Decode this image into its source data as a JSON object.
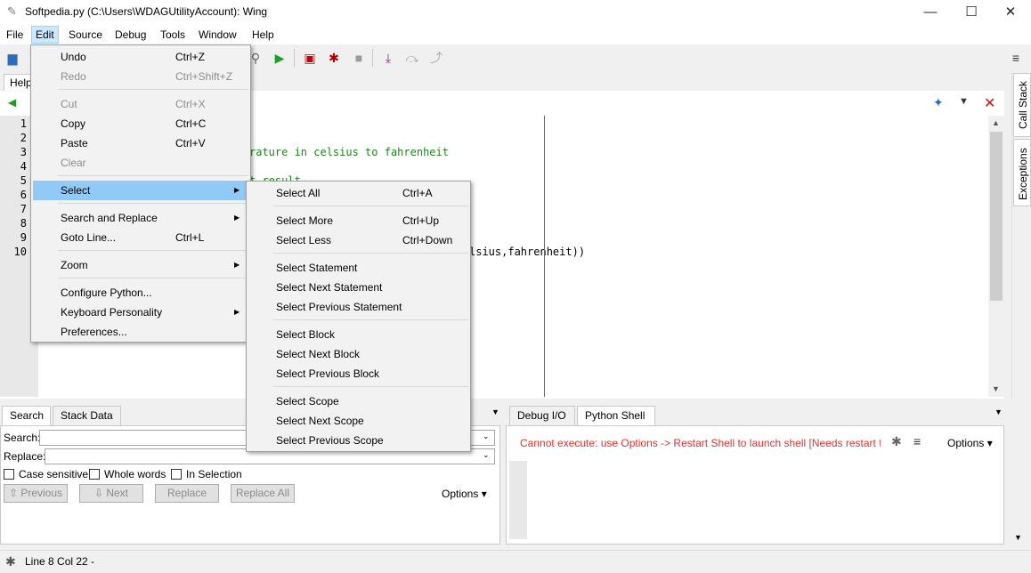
{
  "window": {
    "title": "Softpedia.py (C:\\Users\\WDAGUtilityAccount): Wing",
    "minimize": "—",
    "maximize": "☐",
    "close": "✕"
  },
  "menubar": [
    "File",
    "Edit",
    "Source",
    "Debug",
    "Tools",
    "Window",
    "Help"
  ],
  "editor": {
    "tab_label": "Help",
    "line_numbers": [
      "1",
      "2",
      "3",
      "4",
      "5",
      "6",
      "7",
      "8",
      "9",
      "10"
    ],
    "visible_code": {
      "line3": "rature in celsius to fahrenheit",
      "line5": "t result",
      "line10": "lsius,fahrenheit))"
    }
  },
  "side_tabs": [
    "Call Stack",
    "Exceptions"
  ],
  "edit_menu": {
    "items": [
      {
        "label": "Undo",
        "shortcut": "Ctrl+Z",
        "disabled": false
      },
      {
        "label": "Redo",
        "shortcut": "Ctrl+Shift+Z",
        "disabled": true
      },
      {
        "label": "Cut",
        "shortcut": "Ctrl+X",
        "disabled": true
      },
      {
        "label": "Copy",
        "shortcut": "Ctrl+C",
        "disabled": false
      },
      {
        "label": "Paste",
        "shortcut": "Ctrl+V",
        "disabled": false
      },
      {
        "label": "Clear",
        "shortcut": "",
        "disabled": true
      },
      {
        "label": "Select",
        "shortcut": "",
        "submenu": true
      },
      {
        "label": "Search and Replace",
        "shortcut": "",
        "submenu": true
      },
      {
        "label": "Goto Line...",
        "shortcut": "Ctrl+L"
      },
      {
        "label": "Zoom",
        "shortcut": "",
        "submenu": true
      },
      {
        "label": "Configure Python...",
        "shortcut": ""
      },
      {
        "label": "Keyboard Personality",
        "shortcut": "",
        "submenu": true
      },
      {
        "label": "Preferences...",
        "shortcut": ""
      }
    ]
  },
  "select_submenu": {
    "items": [
      {
        "label": "Select All",
        "shortcut": "Ctrl+A"
      },
      {
        "label": "Select More",
        "shortcut": "Ctrl+Up"
      },
      {
        "label": "Select Less",
        "shortcut": "Ctrl+Down"
      },
      {
        "label": "Select Statement",
        "shortcut": ""
      },
      {
        "label": "Select Next Statement",
        "shortcut": ""
      },
      {
        "label": "Select Previous Statement",
        "shortcut": ""
      },
      {
        "label": "Select Block",
        "shortcut": ""
      },
      {
        "label": "Select Next Block",
        "shortcut": ""
      },
      {
        "label": "Select Previous Block",
        "shortcut": ""
      },
      {
        "label": "Select Scope",
        "shortcut": ""
      },
      {
        "label": "Select Next Scope",
        "shortcut": ""
      },
      {
        "label": "Select Previous Scope",
        "shortcut": ""
      }
    ]
  },
  "search_panel": {
    "tabs": [
      "Search",
      "Stack Data"
    ],
    "search_label": "Search:",
    "replace_label": "Replace:",
    "case_sensitive": "Case sensitive",
    "whole_words": "Whole words",
    "in_selection": "In Selection",
    "previous": "Previous",
    "next": "Next",
    "replace": "Replace",
    "replace_all": "Replace All",
    "options": "Options"
  },
  "shell_panel": {
    "tabs": [
      "Debug I/O",
      "Python Shell"
    ],
    "message": "Cannot execute: use Options -> Restart Shell to launch shell [Needs restart fo",
    "options": "Options"
  },
  "statusbar": {
    "text": "Line 8 Col 22 -"
  },
  "colors": {
    "highlight": "#91c9f7",
    "error_text": "#e53030",
    "code_comment": "#1a8a1a"
  }
}
